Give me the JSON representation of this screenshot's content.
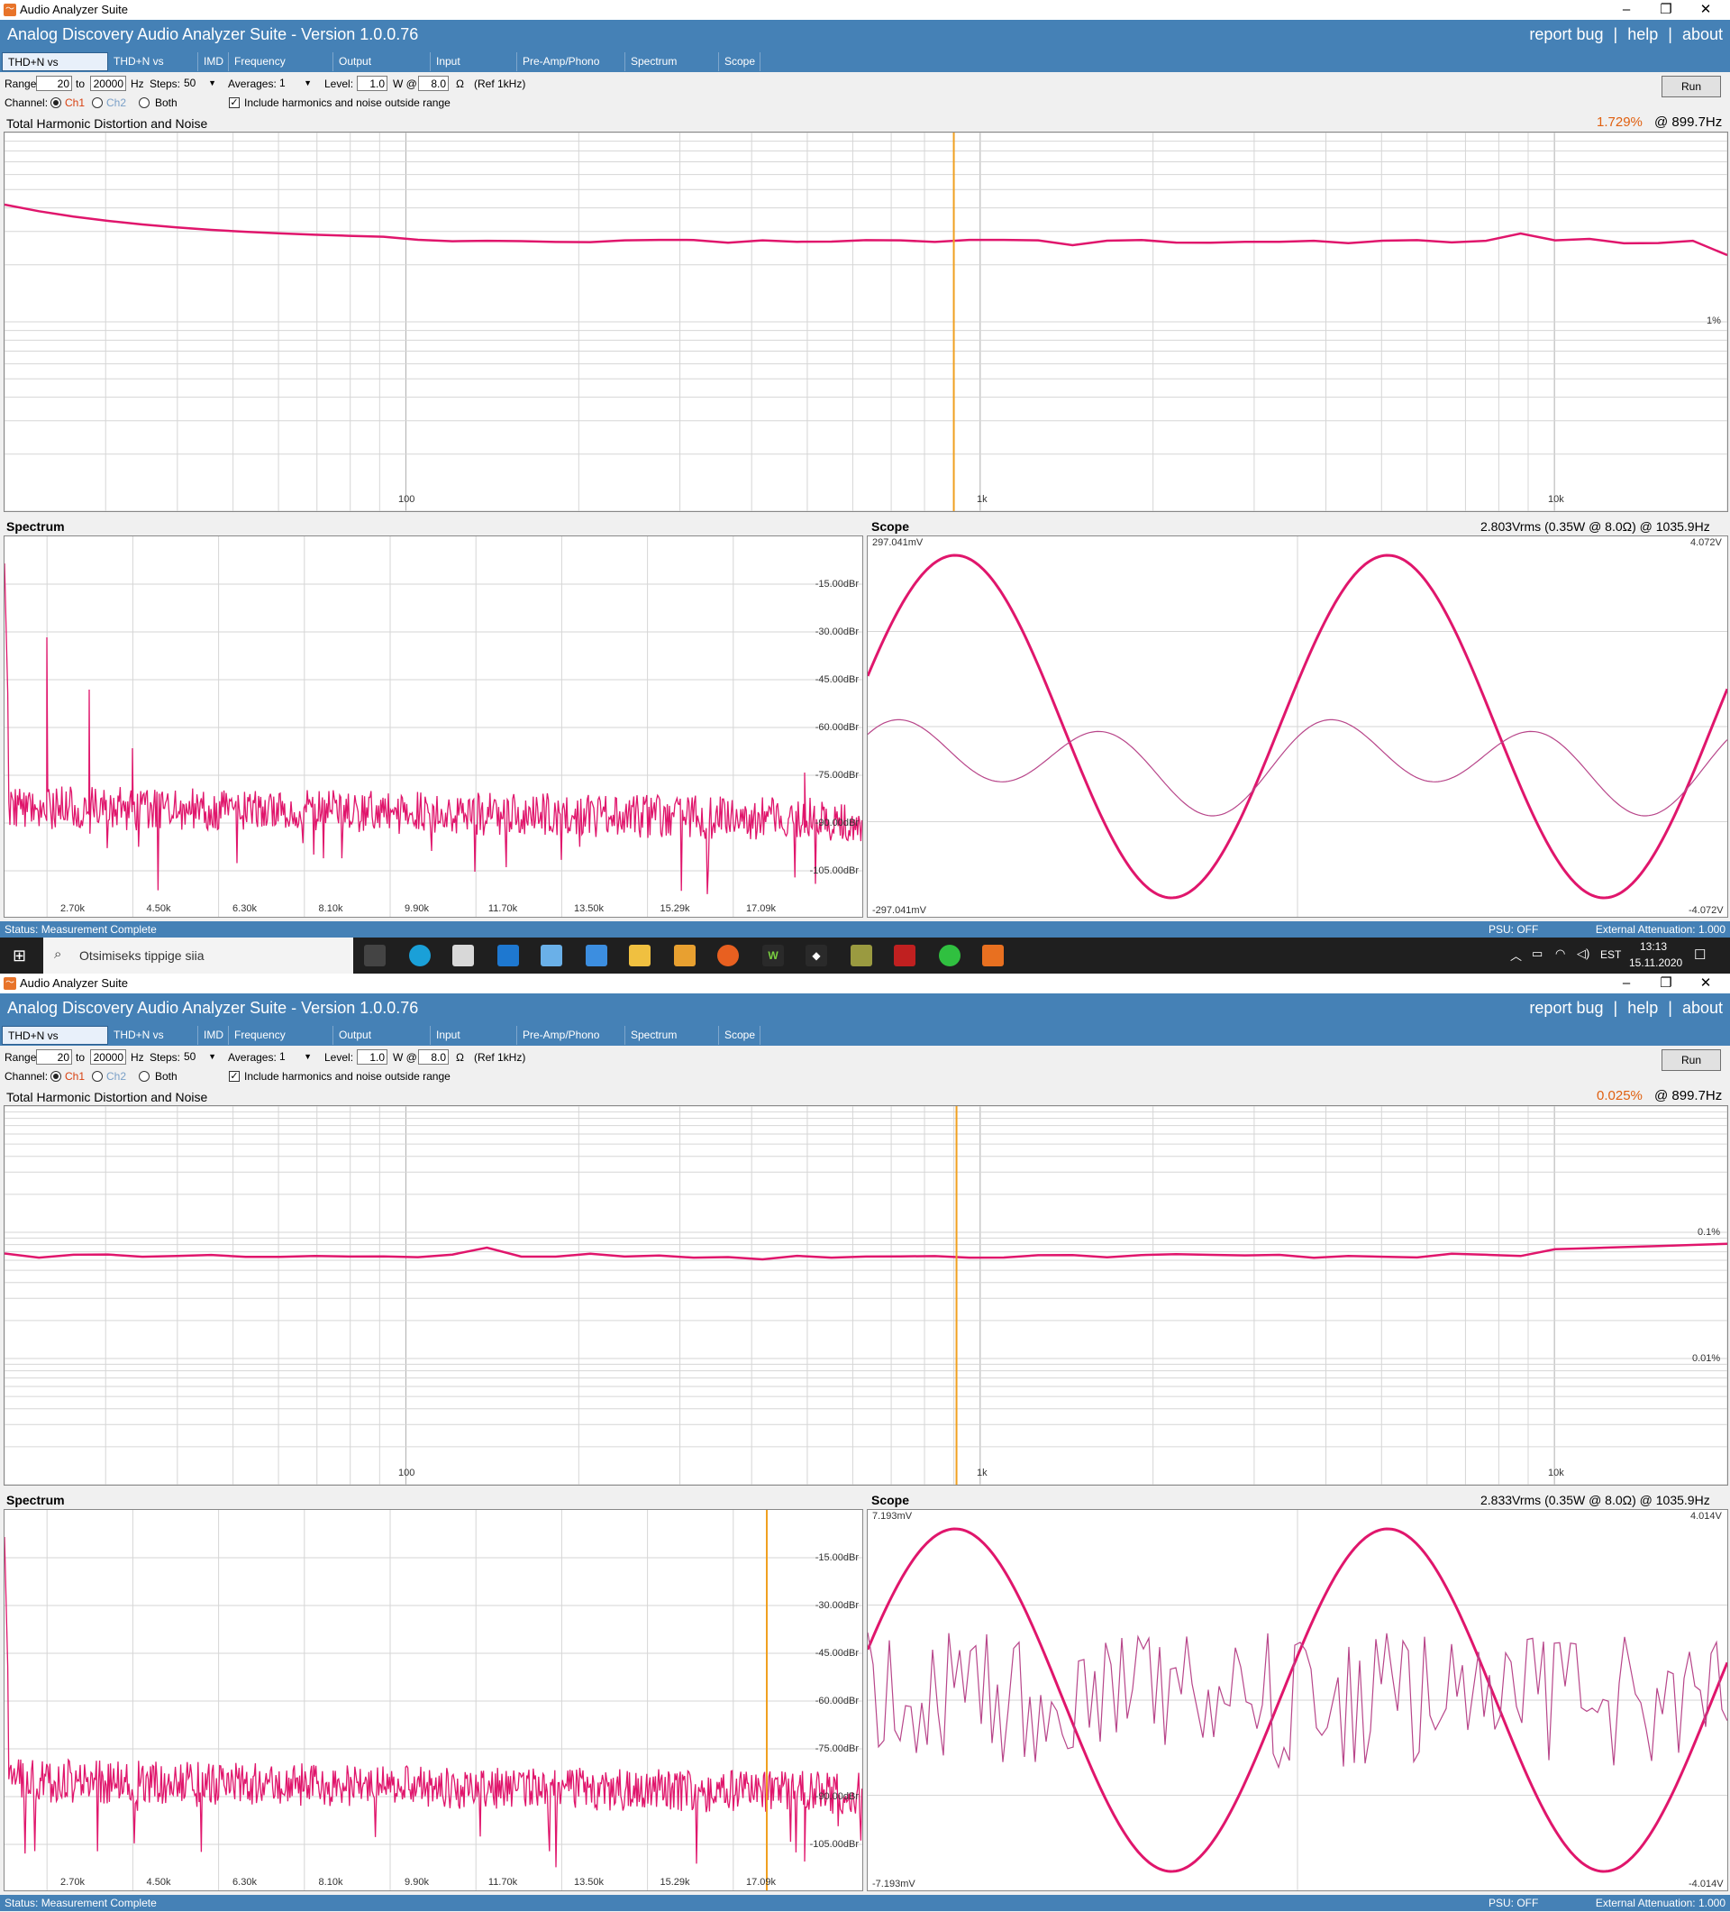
{
  "colors": {
    "accent": "#4581b6",
    "trace": "#e0166c",
    "trace_light": "#b8468a",
    "cursor": "#f0a020",
    "value_orange": "#e06010"
  },
  "windows": [
    {
      "window_title": "Audio Analyzer Suite",
      "app_title": "Analog Discovery Audio Analyzer Suite - Version    1.0.0.76",
      "links": {
        "report": "report bug",
        "sep": "|",
        "help": "help",
        "about": "about"
      },
      "tabs": [
        "THD+N vs Frequency",
        "THD+N vs Power",
        "IMD",
        "Frequency Response",
        "Output Impedance",
        "Input Impedance",
        "Pre-Amp/Phono Stage",
        "Spectrum Analyzer",
        "Scope"
      ],
      "controls": {
        "range_label": "Range:",
        "range_from": "20",
        "to_label": "to",
        "range_to": "20000",
        "hz_label": "Hz",
        "steps_label": "Steps:",
        "steps_value": "50",
        "averages_label": "Averages:",
        "averages_value": "1",
        "level_label": "Level:",
        "level_value": "1.0",
        "w_label": "W @",
        "ohm_value": "8.0",
        "ohm_label": "Ω",
        "ref_label": "(Ref 1kHz)",
        "channel_label": "Channel:",
        "ch1": "Ch1",
        "ch2": "Ch2",
        "both": "Both",
        "include_label": "Include harmonics and noise outside range",
        "run": "Run"
      },
      "thd": {
        "title": "Total Harmonic Distortion and Noise",
        "value": "1.729%",
        "at": "@ 899.7Hz",
        "y_labels": [
          "1%"
        ],
        "x_labels": [
          "100",
          "1k",
          "10k"
        ]
      },
      "spectrum": {
        "title": "Spectrum",
        "db_labels": [
          "-15.00dBr",
          "-30.00dBr",
          "-45.00dBr",
          "-60.00dBr",
          "-75.00dBr",
          "-90.00dBr",
          "-105.00dBr"
        ],
        "freq_labels": [
          "2.70k",
          "4.50k",
          "6.30k",
          "8.10k",
          "9.90k",
          "11.70k",
          "13.50k",
          "15.29k",
          "17.09k"
        ]
      },
      "scope": {
        "title": "Scope",
        "readout": "2.803Vrms (0.35W @ 8.0Ω) @ 1035.9Hz",
        "left_top": "297.041mV",
        "left_bottom": "-297.041mV",
        "right_top": "4.072V",
        "right_bottom": "-4.072V"
      },
      "status": {
        "text": "Status: Measurement Complete",
        "psu": "PSU: OFF",
        "atten": "External Attenuation: 1.000"
      }
    },
    {
      "window_title": "Audio Analyzer Suite",
      "app_title": "Analog Discovery Audio Analyzer Suite - Version    1.0.0.76",
      "links": {
        "report": "report bug",
        "sep": "|",
        "help": "help",
        "about": "about"
      },
      "tabs": [
        "THD+N vs Frequency",
        "THD+N vs Power",
        "IMD",
        "Frequency Response",
        "Output Impedance",
        "Input Impedance",
        "Pre-Amp/Phono Stage",
        "Spectrum Analyzer",
        "Scope"
      ],
      "controls": {
        "range_label": "Range:",
        "range_from": "20",
        "to_label": "to",
        "range_to": "20000",
        "hz_label": "Hz",
        "steps_label": "Steps:",
        "steps_value": "50",
        "averages_label": "Averages:",
        "averages_value": "1",
        "level_label": "Level:",
        "level_value": "1.0",
        "w_label": "W @",
        "ohm_value": "8.0",
        "ohm_label": "Ω",
        "ref_label": "(Ref 1kHz)",
        "channel_label": "Channel:",
        "ch1": "Ch1",
        "ch2": "Ch2",
        "both": "Both",
        "include_label": "Include harmonics and noise outside range",
        "run": "Run"
      },
      "thd": {
        "title": "Total Harmonic Distortion and Noise",
        "value": "0.025%",
        "at": "@ 899.7Hz",
        "y_labels": [
          "0.1%",
          "0.01%"
        ],
        "x_labels": [
          "100",
          "1k",
          "10k"
        ]
      },
      "spectrum": {
        "title": "Spectrum",
        "db_labels": [
          "-15.00dBr",
          "-30.00dBr",
          "-45.00dBr",
          "-60.00dBr",
          "-75.00dBr",
          "-90.00dBr",
          "-105.00dBr"
        ],
        "freq_labels": [
          "2.70k",
          "4.50k",
          "6.30k",
          "8.10k",
          "9.90k",
          "11.70k",
          "13.50k",
          "15.29k",
          "17.09k"
        ]
      },
      "scope": {
        "title": "Scope",
        "readout": "2.833Vrms (0.35W @ 8.0Ω) @ 1035.9Hz",
        "left_top": "7.193mV",
        "left_bottom": "-7.193mV",
        "right_top": "4.014V",
        "right_bottom": "-4.014V"
      },
      "status": {
        "text": "Status: Measurement Complete",
        "psu": "PSU: OFF",
        "atten": "External Attenuation: 1.000"
      }
    }
  ],
  "taskbar": {
    "search_placeholder": "Otsimiseks tippige siia",
    "lang": "EST",
    "time": "13:13",
    "date": "15.11.2020"
  }
}
